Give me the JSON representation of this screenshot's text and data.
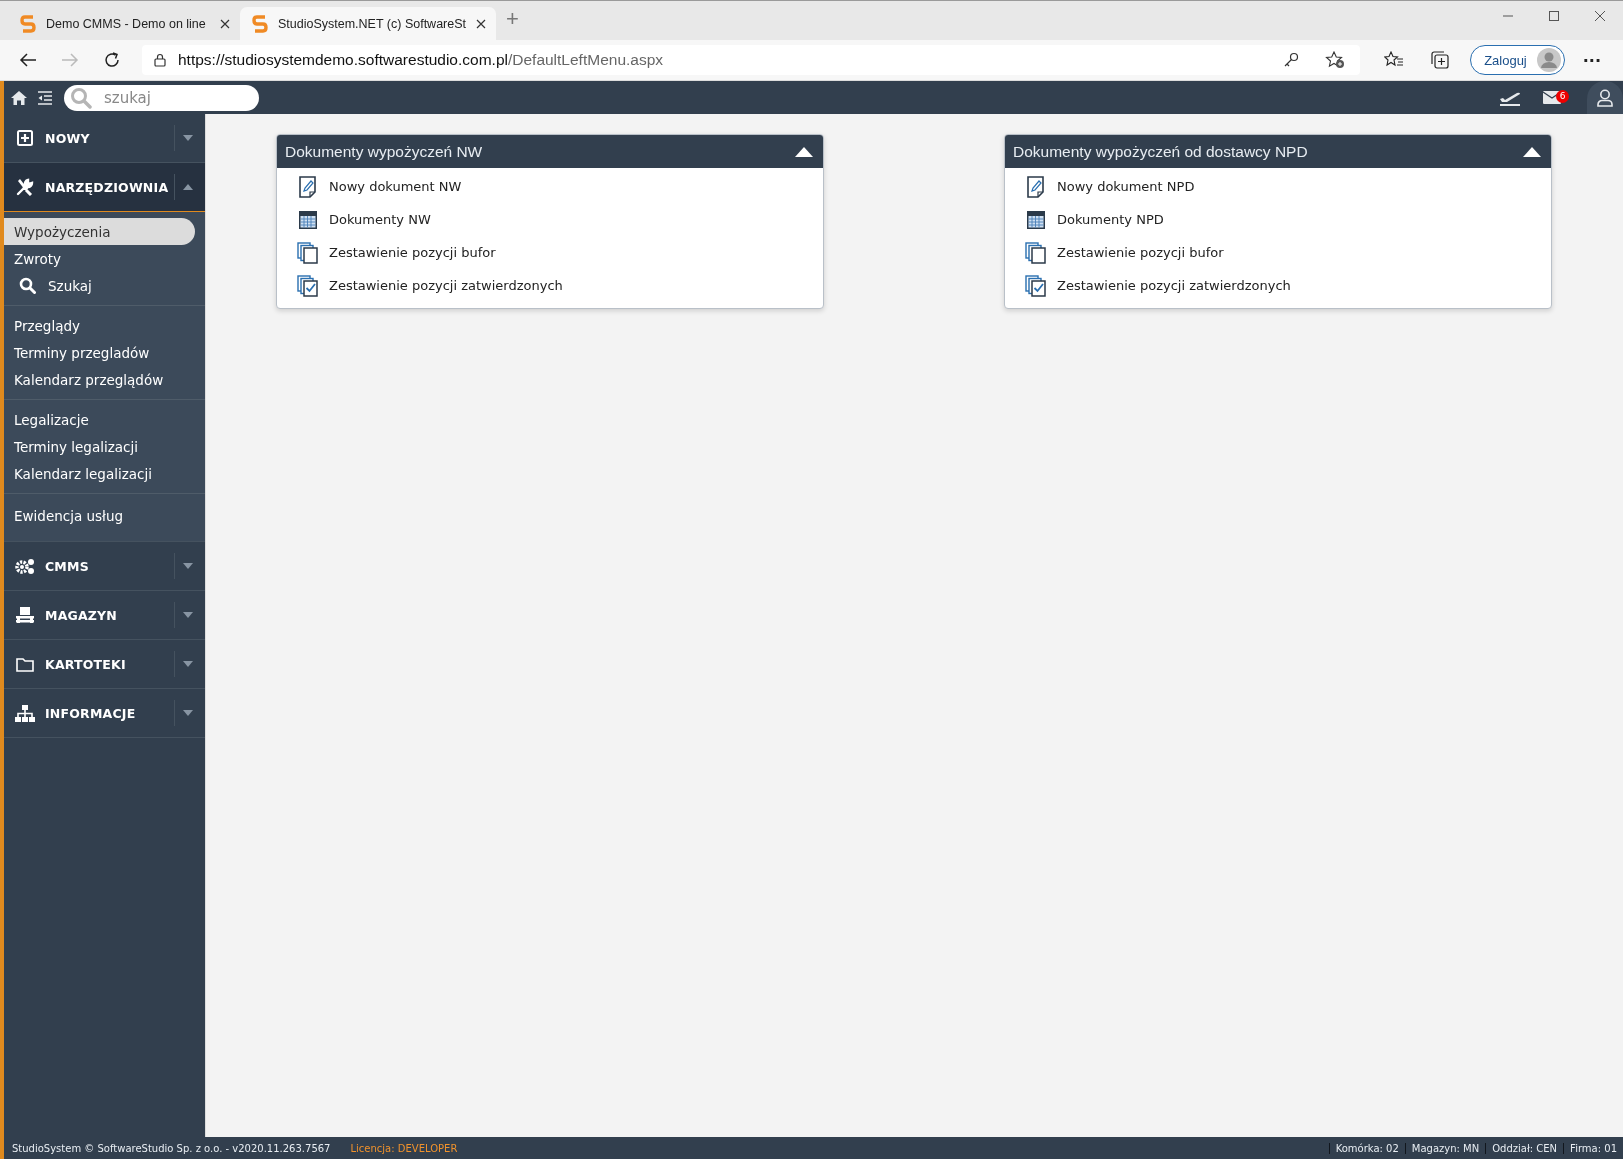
{
  "browser": {
    "tabs": [
      {
        "title": "Demo CMMS - Demo on line",
        "selected": false
      },
      {
        "title": "StudioSystem.NET (c) SoftwareSt",
        "selected": true
      }
    ],
    "new_tab": "+",
    "url": {
      "host": "https://studiosystemdemo.softwarestudio.com.pl",
      "path": "/DefaultLeftMenu.aspx"
    },
    "profile_button": "Zaloguj",
    "more": "···"
  },
  "topbar": {
    "search": {
      "placeholder": "szukaj"
    },
    "mail_badge": "6"
  },
  "sidebar": {
    "sections": [
      {
        "label": "NOWY",
        "kind": "plus",
        "expanded": false
      },
      {
        "label": "NARZĘDZIOWNIA",
        "kind": "tools",
        "expanded": true,
        "groups": [
          [
            {
              "label": "Wypożyczenia",
              "selected": true
            },
            {
              "label": "Zwroty",
              "selected": false
            },
            {
              "label": "Szukaj",
              "selected": false,
              "kind": "search"
            }
          ],
          [
            {
              "label": "Przeglądy",
              "selected": false
            },
            {
              "label": "Terminy przegladów",
              "selected": false
            },
            {
              "label": "Kalendarz przeglądów",
              "selected": false
            }
          ],
          [
            {
              "label": "Legalizacje",
              "selected": false
            },
            {
              "label": "Terminy legalizacji",
              "selected": false
            },
            {
              "label": "Kalendarz legalizacji",
              "selected": false
            }
          ],
          [
            {
              "label": "Ewidencja usług",
              "selected": false
            }
          ]
        ]
      },
      {
        "label": "CMMS",
        "kind": "gears",
        "expanded": false
      },
      {
        "label": "MAGAZYN",
        "kind": "pallet",
        "expanded": false
      },
      {
        "label": "KARTOTEKI",
        "kind": "folder",
        "expanded": false
      },
      {
        "label": "INFORMACJE",
        "kind": "sitemap",
        "expanded": false
      }
    ]
  },
  "cards": [
    {
      "title": "Dokumenty wypożyczeń NW",
      "expanded": true,
      "items": [
        {
          "label": "Nowy dokument NW",
          "kind": "new"
        },
        {
          "label": "Dokumenty NW",
          "kind": "list"
        },
        {
          "label": "Zestawienie pozycji bufor",
          "kind": "copies"
        },
        {
          "label": "Zestawienie pozycji zatwierdzonych",
          "kind": "approved"
        }
      ]
    },
    {
      "title": "Dokumenty wypożyczeń od dostawcy NPD",
      "expanded": true,
      "items": [
        {
          "label": "Nowy dokument NPD",
          "kind": "new"
        },
        {
          "label": "Dokumenty NPD",
          "kind": "list"
        },
        {
          "label": "Zestawienie pozycji bufor",
          "kind": "copies"
        },
        {
          "label": "Zestawienie pozycji zatwierdzonych",
          "kind": "approved"
        }
      ]
    }
  ],
  "footer": {
    "copyright": "StudioSystem © SoftwareStudio Sp. z o.o. - v2020.11.263.7567",
    "license_label": "Licencja:",
    "license_value": "DEVELOPER",
    "fields": [
      {
        "label": "Komórka:",
        "value": "02"
      },
      {
        "label": "Magazyn:",
        "value": "MN"
      },
      {
        "label": "Oddział:",
        "value": "CEN"
      },
      {
        "label": "Firma:",
        "value": "01"
      }
    ]
  }
}
